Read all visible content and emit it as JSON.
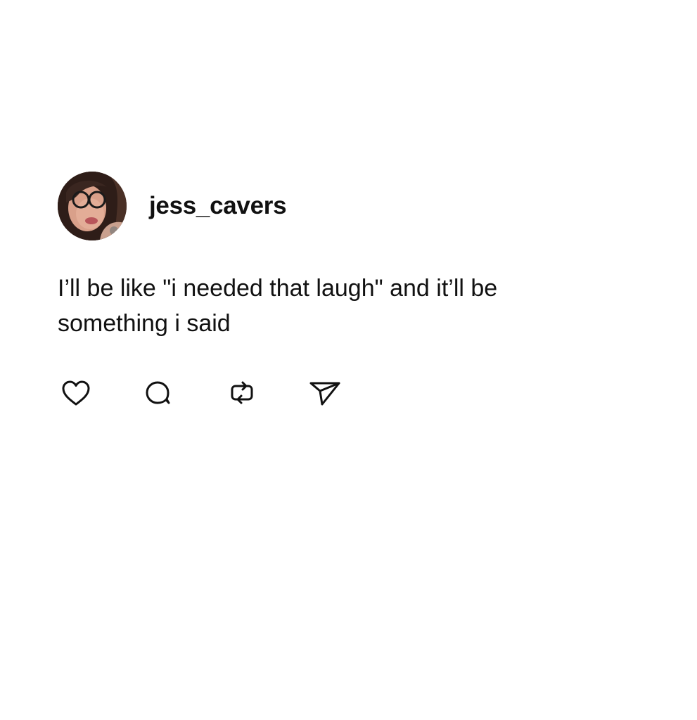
{
  "post": {
    "username": "jess_cavers",
    "text": "I’ll be like \"i needed that laugh\" and it’ll be\nsomething i said",
    "avatar": {
      "description": "profile-photo",
      "colors": {
        "skin": "#d9a08a",
        "hair": "#3a2620",
        "background": "#6b4a3a",
        "glasses": "#1a1a1a",
        "lips": "#b8555a"
      }
    },
    "actions": [
      {
        "name": "like",
        "icon": "heart-icon"
      },
      {
        "name": "comment",
        "icon": "speech-bubble-icon"
      },
      {
        "name": "repost",
        "icon": "repost-arrows-icon"
      },
      {
        "name": "share",
        "icon": "paper-plane-icon"
      }
    ]
  },
  "colors": {
    "background": "#ffffff",
    "text": "#111111",
    "icon_stroke": "#111111"
  }
}
